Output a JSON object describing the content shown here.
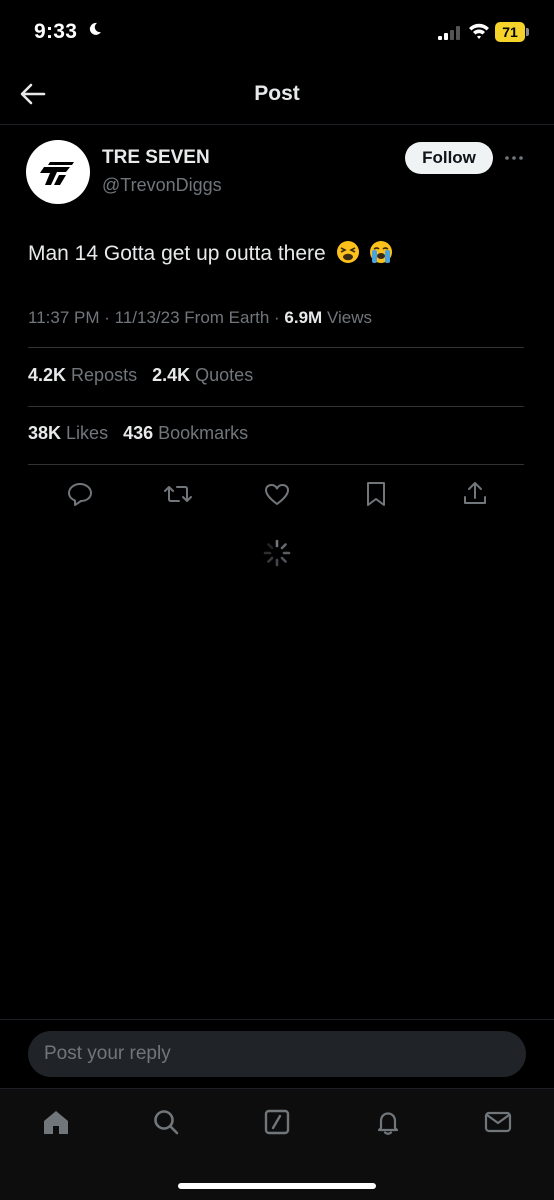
{
  "status_bar": {
    "time": "9:33",
    "battery": "71"
  },
  "header": {
    "title": "Post"
  },
  "author": {
    "display_name": "TRE SEVEN",
    "handle": "@TrevonDiggs",
    "follow_label": "Follow"
  },
  "post": {
    "text": "Man 14 Gotta get up outta there",
    "emojis": [
      "tired-face",
      "loudly-crying-face"
    ],
    "time": "11:37 PM",
    "date": "11/13/23",
    "source": "From Earth",
    "views_count": "6.9M",
    "views_label": "Views"
  },
  "stats": {
    "reposts_count": "4.2K",
    "reposts_label": "Reposts",
    "quotes_count": "2.4K",
    "quotes_label": "Quotes",
    "likes_count": "38K",
    "likes_label": "Likes",
    "bookmarks_count": "436",
    "bookmarks_label": "Bookmarks"
  },
  "actions": [
    "reply-icon",
    "repost-icon",
    "like-icon",
    "bookmark-icon",
    "share-icon"
  ],
  "reply": {
    "placeholder": "Post your reply"
  },
  "tabs": [
    "home-icon",
    "search-icon",
    "compose-icon",
    "notifications-icon",
    "messages-icon"
  ],
  "colors": {
    "background": "#000000",
    "text": "#e7e9ea",
    "muted": "#71767b",
    "battery": "#f5d32b"
  }
}
